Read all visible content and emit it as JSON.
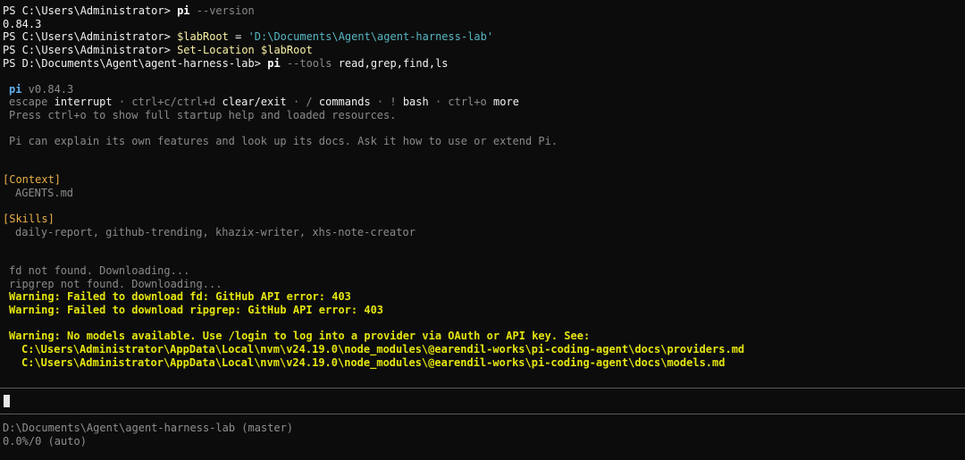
{
  "shell": {
    "lines": [
      {
        "prompt": "PS C:\\Users\\Administrator> ",
        "cmd": "pi",
        "args": " --version"
      },
      {
        "output": "0.84.3"
      },
      {
        "prompt": "PS C:\\Users\\Administrator> ",
        "cmd": "$labRoot",
        "op": " = ",
        "str": "'D:\\Documents\\Agent\\agent-harness-lab'"
      },
      {
        "prompt": "PS C:\\Users\\Administrator> ",
        "cmd": "Set-Location",
        "var": " $labRoot"
      },
      {
        "prompt": "PS D:\\Documents\\Agent\\agent-harness-lab> ",
        "cmd": "pi",
        "args": " --tools ",
        "argv": "read,grep,find,ls"
      }
    ]
  },
  "pi_header": {
    "name": "pi",
    "version": " v0.84.3",
    "keys": [
      {
        "key": "escape",
        "action": "interrupt"
      },
      {
        "key": "ctrl+c/ctrl+d",
        "action": "clear/exit"
      },
      {
        "key": "/",
        "action": "commands"
      },
      {
        "key": "!",
        "action": "bash"
      },
      {
        "key": "ctrl+o",
        "action": "more"
      }
    ],
    "sep": " · ",
    "help_line": "Press ctrl+o to show full startup help and loaded resources.",
    "intro": "Pi can explain its own features and look up its docs. Ask it how to use or extend Pi."
  },
  "context": {
    "label": "[Context]",
    "items": "AGENTS.md"
  },
  "skills": {
    "label": "[Skills]",
    "items": "daily-report, github-trending, khazix-writer, xhs-note-creator"
  },
  "downloads": {
    "fd": "fd not found. Downloading...",
    "ripgrep": "ripgrep not found. Downloading...",
    "warn_fd": "Warning: Failed to download fd: GitHub API error: 403",
    "warn_rg": "Warning: Failed to download ripgrep: GitHub API error: 403"
  },
  "models_warning": {
    "text": "Warning: No models available. Use /login to log into a provider via OAuth or API key. See:",
    "providers_doc": "C:\\Users\\Administrator\\AppData\\Local\\nvm\\v24.19.0\\node_modules\\@earendil-works\\pi-coding-agent\\docs\\providers.md",
    "models_doc": "C:\\Users\\Administrator\\AppData\\Local\\nvm\\v24.19.0\\node_modules\\@earendil-works\\pi-coding-agent\\docs\\models.md"
  },
  "footer": {
    "path": "D:\\Documents\\Agent\\agent-harness-lab (master)",
    "usage": "0.0%/0 (auto)"
  },
  "colors": {
    "background": "#0c0c0c",
    "warning": "#e5e510",
    "section": "#e8b04b",
    "string": "#56b6c2",
    "pi_brand": "#61afef"
  }
}
